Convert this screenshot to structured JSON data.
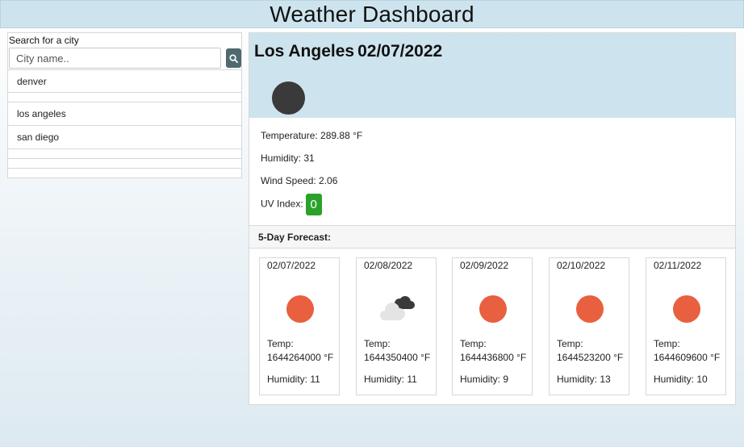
{
  "header": {
    "title": "Weather Dashboard"
  },
  "search": {
    "label": "Search for a city",
    "placeholder": "City name..",
    "value": ""
  },
  "history": [
    "denver",
    "",
    "los angeles",
    "san diego",
    "",
    "",
    ""
  ],
  "current": {
    "city": "Los Angeles",
    "date": "02/07/2022",
    "icon": "dark-circle-icon",
    "temperature": "Temperature: 289.88 °F",
    "humidity": "Humidity: 31",
    "wind": "Wind Speed: 2.06",
    "uv_label": "UV Index:",
    "uv_value": "0",
    "uv_color": "#2aa22a"
  },
  "forecast": {
    "title": "5-Day Forecast:",
    "days": [
      {
        "date": "02/07/2022",
        "icon": "sun-icon",
        "temp_label": "Temp:",
        "temp": "1644264000 °F",
        "humidity": "Humidity: 11"
      },
      {
        "date": "02/08/2022",
        "icon": "clouds-icon",
        "temp_label": "Temp:",
        "temp": "1644350400 °F",
        "humidity": "Humidity: 11"
      },
      {
        "date": "02/09/2022",
        "icon": "sun-icon",
        "temp_label": "Temp:",
        "temp": "1644436800 °F",
        "humidity": "Humidity: 9"
      },
      {
        "date": "02/10/2022",
        "icon": "sun-icon",
        "temp_label": "Temp:",
        "temp": "1644523200 °F",
        "humidity": "Humidity: 13"
      },
      {
        "date": "02/11/2022",
        "icon": "sun-icon",
        "temp_label": "Temp:",
        "temp": "1644609600 °F",
        "humidity": "Humidity: 10"
      }
    ]
  },
  "colors": {
    "accent": "#cde4ee",
    "sun": "#e8603f",
    "search_button": "#4f6970"
  }
}
